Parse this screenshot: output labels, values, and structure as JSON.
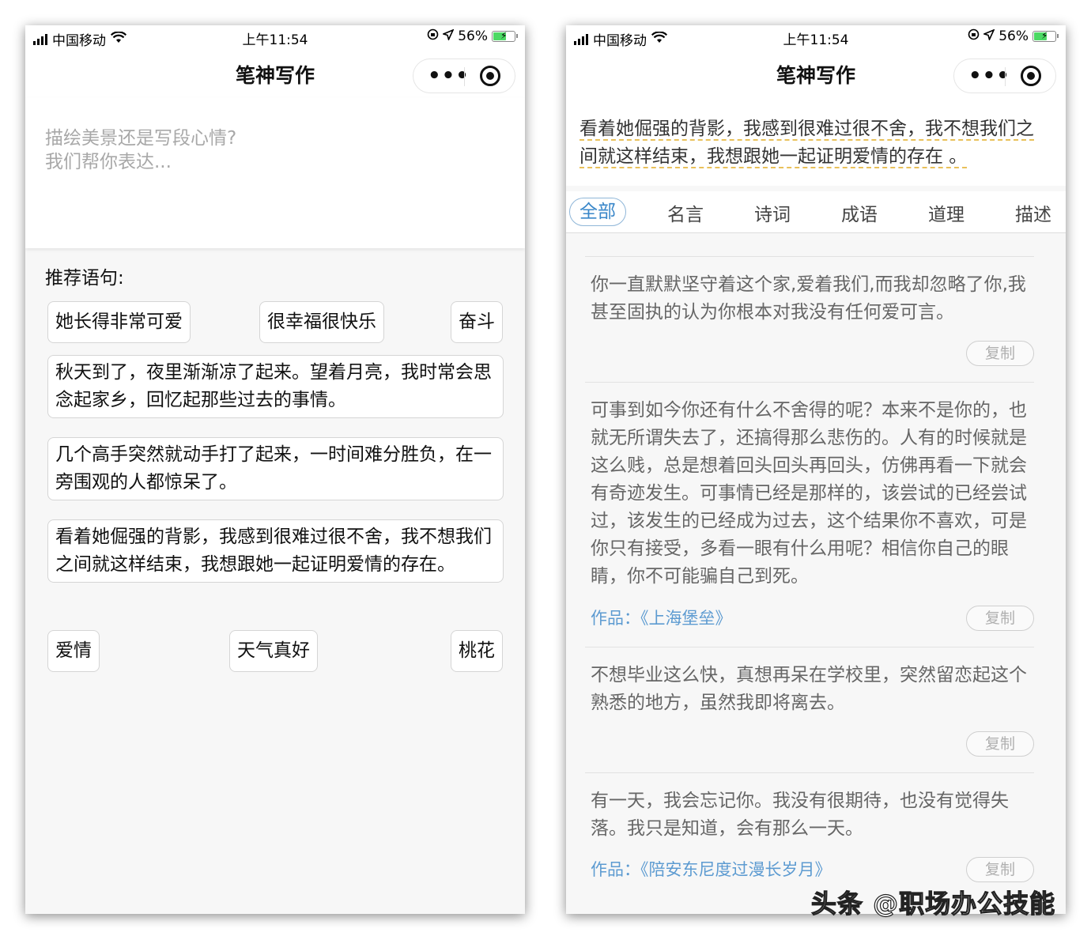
{
  "status": {
    "carrier": "中国移动",
    "time": "上午11:54",
    "battery": "56%"
  },
  "app_title": "笔神写作",
  "capsule": {
    "more_glyph": "•••"
  },
  "left": {
    "placeholder": "描绘美景还是写段心情?\n我们帮你表达...",
    "rec_label": "推荐语句:",
    "chips_row1": [
      "她长得非常可爱",
      "很幸福很快乐",
      "奋斗"
    ],
    "sentences": [
      "秋天到了，夜里渐渐凉了起来。望着月亮，我时常会思念起家乡，回忆起那些过去的事情。",
      "几个高手突然就动手打了起来，一时间难分胜负，在一旁围观的人都惊呆了。",
      "看着她倔强的背影，我感到很难过很不舍，我不想我们之间就这样结束，我想跟她一起证明爱情的存在。"
    ],
    "chips_row2": [
      "爱情",
      "天气真好",
      "桃花"
    ]
  },
  "right": {
    "sentence": "看着她倔强的背影，我感到很难过很不舍，我不想我们之间就这样结束，我想跟她一起证明爱情的存在 。",
    "tabs": [
      "全部",
      "名言",
      "诗词",
      "成语",
      "道理",
      "描述"
    ],
    "active_tab": "全部",
    "copy_label": "复制",
    "cards": [
      {
        "text": "你一直默默坚守着这个家,爱着我们,而我却忽略了你,我甚至固执的认为你根本对我没有任何爱可言。",
        "source": ""
      },
      {
        "text": "可事到如今你还有什么不舍得的呢？本来不是你的，也就无所谓失去了，还搞得那么悲伤的。人有的时候就是这么贱，总是想着回头回头再回头，仿佛再看一下就会有奇迹发生。可事情已经是那样的，该尝试的已经尝试过，该发生的已经成为过去，这个结果你不喜欢，可是你只有接受，多看一眼有什么用呢？相信你自己的眼睛，你不可能骗自己到死。",
        "source": "作品：《上海堡垒》"
      },
      {
        "text": "不想毕业这么快，真想再呆在学校里，突然留恋起这个熟悉的地方，虽然我即将离去。",
        "source": ""
      },
      {
        "text": "有一天，我会忘记你。我没有很期待，也没有觉得失落。我只是知道，会有那么一天。",
        "source": "作品：《陪安东尼度过漫长岁月》"
      }
    ]
  },
  "watermark": "头条 @职场办公技能"
}
